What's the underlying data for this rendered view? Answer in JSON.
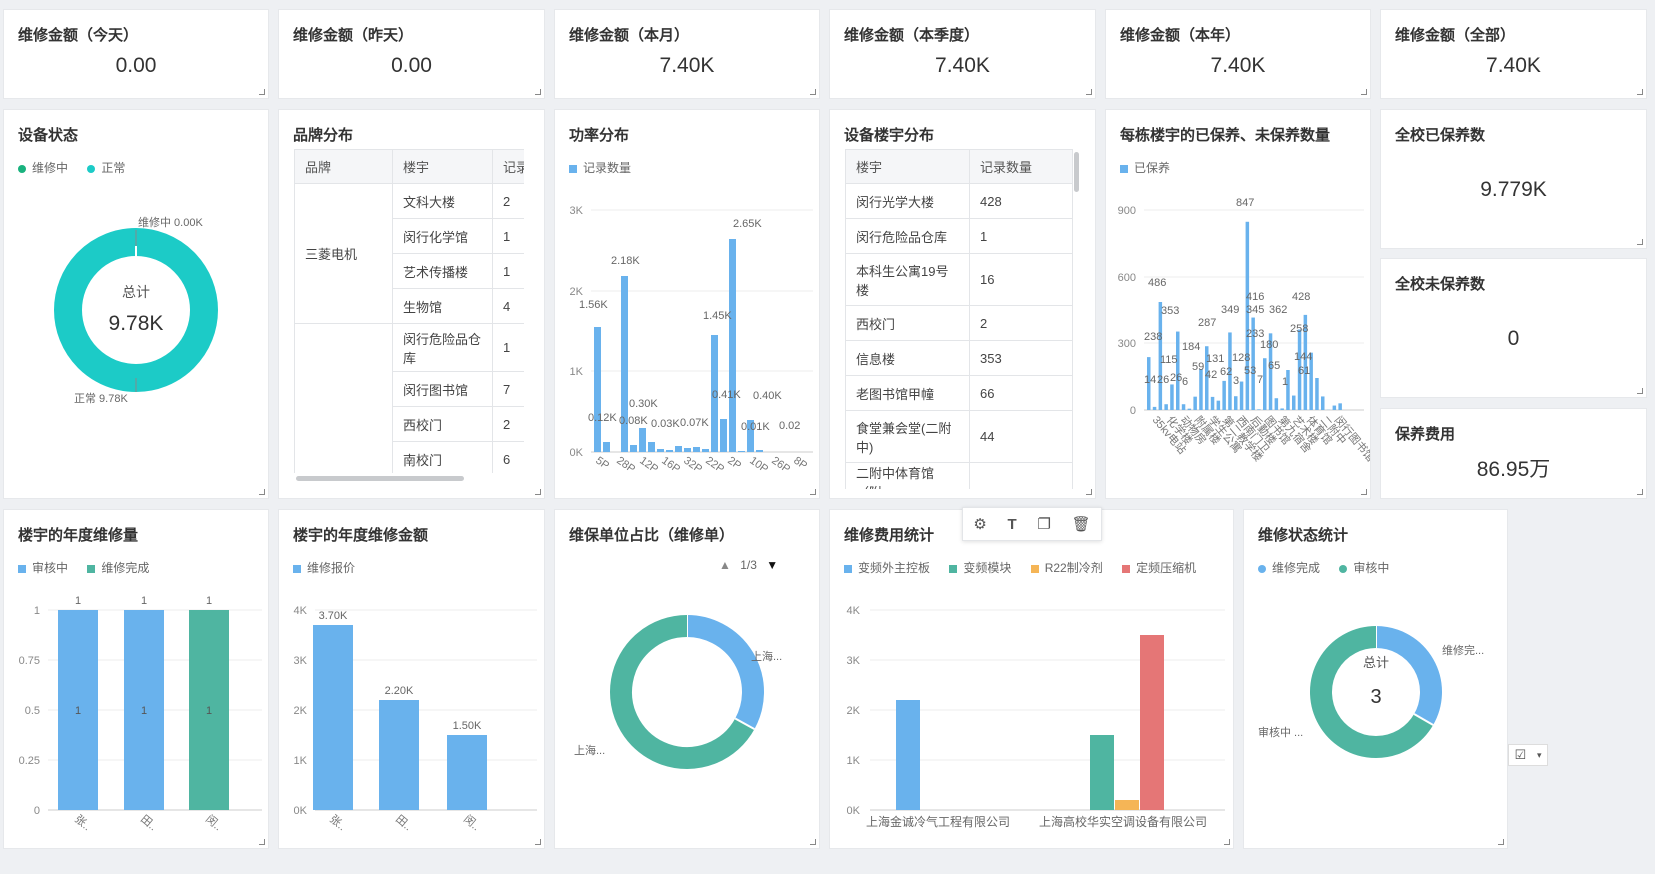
{
  "kpis": [
    {
      "title": "维修金额（今天）",
      "value": "0.00"
    },
    {
      "title": "维修金额（昨天）",
      "value": "0.00"
    },
    {
      "title": "维修金额（本月）",
      "value": "7.40K"
    },
    {
      "title": "维修金额（本季度）",
      "value": "7.40K"
    },
    {
      "title": "维修金额（本年）",
      "value": "7.40K"
    },
    {
      "title": "维修金额（全部）",
      "value": "7.40K"
    }
  ],
  "device_status": {
    "title": "设备状态",
    "legend": [
      "维修中",
      "正常"
    ],
    "colors": [
      "#19b27e",
      "#1ccbc7"
    ],
    "center_label": "总计",
    "center_value": "9.78K",
    "label_repair": "维修中  0.00K",
    "label_normal": "正常  9.78K"
  },
  "brand": {
    "title": "品牌分布",
    "headers": [
      "品牌",
      "楼宇",
      "记录"
    ],
    "group1": "三菱电机",
    "rows": [
      {
        "building": "文科大楼",
        "count": "2"
      },
      {
        "building": "闵行化学馆",
        "count": "1"
      },
      {
        "building": "艺术传播楼",
        "count": "1"
      },
      {
        "building": "生物馆",
        "count": "4"
      },
      {
        "building": "闵行危险品仓库",
        "count": "1"
      },
      {
        "building": "闵行图书馆",
        "count": "7"
      },
      {
        "building": "西校门",
        "count": "2"
      },
      {
        "building": "南校门",
        "count": "6"
      }
    ]
  },
  "power": {
    "title": "功率分布",
    "legend": "记录数量",
    "color": "#69b2ed",
    "yticks": [
      "3K",
      "2K",
      "1K",
      "0K"
    ],
    "xticks": [
      "5P",
      "28P",
      "12P",
      "16P",
      "32P",
      "22P",
      "2P",
      "10P",
      "26P",
      "8P"
    ],
    "labels": [
      "1.56K",
      "0.12K",
      "2.18K",
      "0.08K",
      "0.30K",
      "0.03K",
      "0.07K",
      "1.45K",
      "0.41K",
      "2.65K",
      "0.01K",
      "0.40K",
      "0.02"
    ]
  },
  "bld_table": {
    "title": "设备楼宇分布",
    "headers": [
      "楼宇",
      "记录数量"
    ],
    "rows": [
      {
        "name": "闵行光学大楼",
        "count": "428"
      },
      {
        "name": "闵行危险品仓库",
        "count": "1"
      },
      {
        "name": "本科生公寓19号楼",
        "count": "16"
      },
      {
        "name": "西校门",
        "count": "2"
      },
      {
        "name": "信息楼",
        "count": "353"
      },
      {
        "name": "老图书馆甲幢",
        "count": "66"
      },
      {
        "name": "食堂兼会堂(二附中)",
        "count": "44"
      },
      {
        "name": "二附中体育馆（附",
        "count": ""
      }
    ]
  },
  "maint": {
    "title": "每栋楼宇的已保养、未保养数量",
    "legend": "已保养",
    "color": "#69b2ed",
    "yticks": [
      "900",
      "600",
      "300",
      "0"
    ],
    "labels": [
      "847",
      "486",
      "353",
      "238",
      "115",
      "14",
      "26",
      "26",
      "6",
      "287",
      "184",
      "59",
      "42",
      "131",
      "349",
      "416",
      "345",
      "62",
      "3",
      "233",
      "128",
      "53",
      "7",
      "180",
      "65",
      "362",
      "428",
      "258",
      "144",
      "61",
      "1"
    ],
    "xticks": [
      "35kv电站",
      "化学楼",
      "动物房",
      "附属楼",
      "学生公寓",
      "第二教学楼",
      "西南门卫",
      "后勤楼",
      "图书馆",
      "第九宿舍",
      "艺术楼",
      "体育馆",
      "二附中",
      "闵行图书馆"
    ]
  },
  "total_maint": {
    "title": "全校已保养数",
    "value": "9.779K"
  },
  "total_unmaint": {
    "title": "全校未保养数",
    "value": "0"
  },
  "maint_fee": {
    "title": "保养费用",
    "value": "86.95万"
  },
  "year_repair": {
    "title": "楼宇的年度维修量",
    "legend": [
      "审核中",
      "维修完成"
    ],
    "colors": [
      "#69b2ed",
      "#4fb5a1"
    ],
    "yticks": [
      "1",
      "0.75",
      "0.5",
      "0.25",
      "0"
    ],
    "chart_data": {
      "type": "bar",
      "categories": [
        "张..",
        "田..",
        "闵.."
      ],
      "series": [
        {
          "name": "审核中",
          "values": [
            1,
            1,
            0
          ]
        },
        {
          "name": "维修完成",
          "values": [
            0,
            0,
            1
          ]
        }
      ],
      "ylim": [
        0,
        1
      ]
    }
  },
  "year_amount": {
    "title": "楼宇的年度维修金额",
    "legend": "维修报价",
    "color": "#69b2ed",
    "yticks": [
      "4K",
      "3K",
      "2K",
      "1K",
      "0K"
    ],
    "chart_data": {
      "type": "bar",
      "categories": [
        "张..",
        "田..",
        "闵.."
      ],
      "values": [
        3700,
        2200,
        1500
      ],
      "labels": [
        "3.70K",
        "2.20K",
        "1.50K"
      ],
      "ylim": [
        0,
        4000
      ]
    }
  },
  "unit_share": {
    "title": "维保单位占比（维修单）",
    "pager": "1/3",
    "label_a": "上海...",
    "label_b": "上海...",
    "chart_data": {
      "type": "pie",
      "segments": [
        {
          "name": "上海...",
          "value": 0.33,
          "color": "#69b2ed"
        },
        {
          "name": "上海...",
          "value": 0.67,
          "color": "#4fb5a1"
        }
      ]
    }
  },
  "repair_fee": {
    "title": "维修费用统计",
    "legend": [
      "变频外主控板",
      "变频模块",
      "R22制冷剂",
      "定频压缩机"
    ],
    "colors": [
      "#69b2ed",
      "#4fb5a1",
      "#f5b556",
      "#e57676"
    ],
    "yticks": [
      "4K",
      "3K",
      "2K",
      "1K",
      "0K"
    ],
    "chart_data": {
      "type": "bar",
      "categories": [
        "上海金诚冷气工程有限公司",
        "上海高校华实空调设备有限公司"
      ],
      "series": [
        {
          "name": "变频外主控板",
          "values": [
            2200,
            0
          ]
        },
        {
          "name": "变频模块",
          "values": [
            0,
            1500
          ]
        },
        {
          "name": "R22制冷剂",
          "values": [
            0,
            200
          ]
        },
        {
          "name": "定频压缩机",
          "values": [
            0,
            3500
          ]
        }
      ],
      "labels": [
        "2.20K",
        "1.50K",
        "0.20K",
        "3.50K"
      ],
      "ylim": [
        0,
        4000
      ]
    }
  },
  "repair_status": {
    "title": "维修状态统计",
    "legend": [
      "维修完成",
      "审核中"
    ],
    "colors": [
      "#69b2ed",
      "#4fb5a1"
    ],
    "center_label": "总计",
    "center_value": "3",
    "label_done": "维修完...",
    "label_audit": "审核中 ...",
    "chart_data": {
      "type": "pie",
      "segments": [
        {
          "name": "维修完成",
          "value": 1,
          "color": "#69b2ed"
        },
        {
          "name": "审核中",
          "value": 2,
          "color": "#4fb5a1"
        }
      ]
    }
  }
}
